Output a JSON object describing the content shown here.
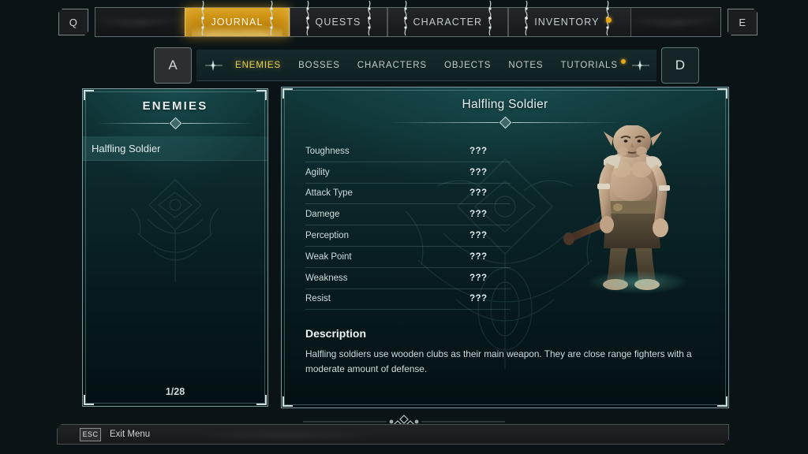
{
  "top_nav": {
    "left_key": "Q",
    "right_key": "E",
    "tabs": [
      {
        "label": "JOURNAL",
        "active": true,
        "badge": false
      },
      {
        "label": "QUESTS",
        "active": false,
        "badge": false
      },
      {
        "label": "CHARACTER",
        "active": false,
        "badge": false
      },
      {
        "label": "INVENTORY",
        "active": false,
        "badge": true
      }
    ]
  },
  "sub_nav": {
    "left_key": "A",
    "right_key": "D",
    "tabs": [
      {
        "label": "ENEMIES",
        "active": true,
        "badge": false
      },
      {
        "label": "BOSSES",
        "active": false,
        "badge": false
      },
      {
        "label": "CHARACTERS",
        "active": false,
        "badge": false
      },
      {
        "label": "OBJECTS",
        "active": false,
        "badge": false
      },
      {
        "label": "NOTES",
        "active": false,
        "badge": false
      },
      {
        "label": "TUTORIALS",
        "active": false,
        "badge": true
      }
    ]
  },
  "left_panel": {
    "title": "ENEMIES",
    "items": [
      {
        "label": "Halfling Soldier",
        "selected": true
      }
    ],
    "counter": "1/28"
  },
  "detail_panel": {
    "title": "Halfling Soldier",
    "stats": [
      {
        "label": "Toughness",
        "value": "???"
      },
      {
        "label": "Agility",
        "value": "???"
      },
      {
        "label": "Attack Type",
        "value": "???"
      },
      {
        "label": "Damege",
        "value": "???"
      },
      {
        "label": "Perception",
        "value": "???"
      },
      {
        "label": "Weak Point",
        "value": "???"
      },
      {
        "label": "Weakness",
        "value": "???"
      },
      {
        "label": "Resist",
        "value": "???"
      }
    ],
    "description_heading": "Description",
    "description_text": "Halfling soldiers use wooden clubs as their main weapon. They are close range fighters with a moderate amount of defense.",
    "creature_art": "halfling-soldier-portrait"
  },
  "bottom_bar": {
    "key": "ESC",
    "label": "Exit Menu"
  },
  "colors": {
    "accent_gold": "#d59b18",
    "accent_yellow": "#e8cf4a",
    "badge_orange": "#e8a516",
    "panel_teal": "#0b2629",
    "panel_border": "#7f9a9b",
    "background": "#0a1416"
  }
}
